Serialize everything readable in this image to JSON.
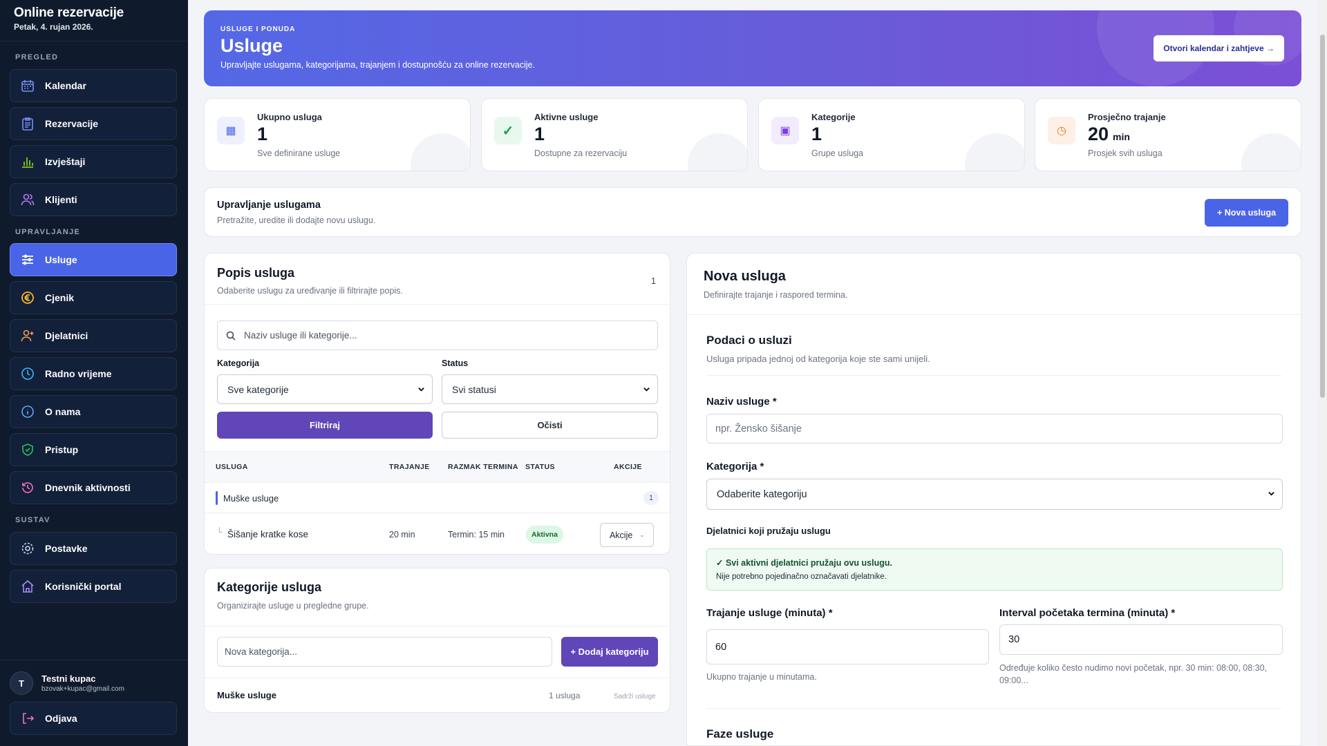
{
  "sidebar": {
    "brand_title": "Online rezervacije",
    "brand_date": "Petak, 4. rujan 2026.",
    "sections": {
      "overview": "PREGLED",
      "manage": "UPRAVLJANJE",
      "system": "SUSTAV"
    },
    "items": [
      {
        "label": "Kalendar",
        "icon": "calendar-icon"
      },
      {
        "label": "Rezervacije",
        "icon": "clipboard-icon"
      },
      {
        "label": "Izvještaji",
        "icon": "bar-chart-icon"
      },
      {
        "label": "Klijenti",
        "icon": "users-icon"
      },
      {
        "label": "Usluge",
        "icon": "sliders-icon"
      },
      {
        "label": "Cjenik",
        "icon": "euro-icon"
      },
      {
        "label": "Djelatnici",
        "icon": "user-add-icon"
      },
      {
        "label": "Radno vrijeme",
        "icon": "clock-icon"
      },
      {
        "label": "O nama",
        "icon": "info-icon"
      },
      {
        "label": "Pristup",
        "icon": "shield-check-icon"
      },
      {
        "label": "Dnevnik aktivnosti",
        "icon": "history-icon"
      },
      {
        "label": "Postavke",
        "icon": "gear-icon"
      },
      {
        "label": "Korisnički portal",
        "icon": "home-icon"
      }
    ],
    "user": {
      "initial": "T",
      "name": "Testni kupac",
      "email": "bzovak+kupac@gmail.com"
    },
    "logout": "Odjava"
  },
  "hero": {
    "kicker": "USLUGE I PONUDA",
    "title": "Usluge",
    "subtitle": "Upravljajte uslugama, kategorijama, trajanjem i dostupnošću za online rezervacije.",
    "button": "Otvori kalendar i zahtjeve →"
  },
  "stats": [
    {
      "label": "Ukupno usluga",
      "value": "1",
      "unit": "",
      "sub": "Sve definirane usluge"
    },
    {
      "label": "Aktivne usluge",
      "value": "1",
      "unit": "",
      "sub": "Dostupne za rezervaciju"
    },
    {
      "label": "Kategorije",
      "value": "1",
      "unit": "",
      "sub": "Grupe usluga"
    },
    {
      "label": "Prosječno trajanje",
      "value": "20",
      "unit": "min",
      "sub": "Prosjek svih usluga"
    }
  ],
  "manage": {
    "title": "Upravljanje uslugama",
    "subtitle": "Pretražite, uredite ili dodajte novu uslugu.",
    "button": "+ Nova usluga"
  },
  "list": {
    "title": "Popis usluga",
    "subtitle": "Odaberite uslugu za uređivanje ili filtrirajte popis.",
    "count": "1",
    "search_placeholder": "Naziv usluge ili kategorije...",
    "category_label": "Kategorija",
    "category_value": "Sve kategorije",
    "status_label": "Status",
    "status_value": "Svi statusi",
    "filter_btn": "Filtriraj",
    "clear_btn": "Očisti",
    "columns": [
      "USLUGA",
      "TRAJANJE",
      "RAZMAK TERMINA",
      "STATUS",
      "AKCIJE"
    ],
    "group": {
      "name": "Muške usluge",
      "count": "1"
    },
    "row": {
      "prefix": "└",
      "name": "Šišanje kratke kose",
      "duration": "20 min",
      "interval": "Termin: 15 min",
      "status": "Aktivna",
      "action": "Akcije"
    }
  },
  "categories": {
    "title": "Kategorije usluga",
    "subtitle": "Organizirajte usluge u pregledne grupe.",
    "input_placeholder": "Nova kategorija...",
    "add_btn": "+ Dodaj kategoriju",
    "row": {
      "name": "Muške usluge",
      "count": "1 usluga",
      "note": "Sadrži usluge"
    }
  },
  "form": {
    "title": "Nova usluga",
    "subtitle": "Definirajte trajanje i raspored termina.",
    "section_title": "Podaci o usluzi",
    "section_sub": "Usluga pripada jednoj od kategorija koje ste sami unijeli.",
    "name_label": "Naziv usluge *",
    "name_placeholder": "npr. Žensko šišanje",
    "category_label": "Kategorija *",
    "category_value": "Odaberite kategoriju",
    "staff_label": "Djelatnici koji pružaju uslugu",
    "staff_note_title": "✓ Svi aktivni djelatnici pružaju ovu uslugu.",
    "staff_note_sub": "Nije potrebno pojedinačno označavati djelatnike.",
    "duration_label": "Trajanje usluge (minuta) *",
    "duration_value": "60",
    "duration_help": "Ukupno trajanje u minutama.",
    "interval_label": "Interval početaka termina (minuta) *",
    "interval_value": "30",
    "interval_help": "Određuje koliko često nudimo novi početak, npr. 30 min: 08:00, 08:30, 09:00...",
    "phases_title": "Faze usluge"
  },
  "colors": {
    "primary": "#4a64e8",
    "purple": "#6046b8",
    "sidebar": "#0f1b2d",
    "success": "#16a34a"
  }
}
